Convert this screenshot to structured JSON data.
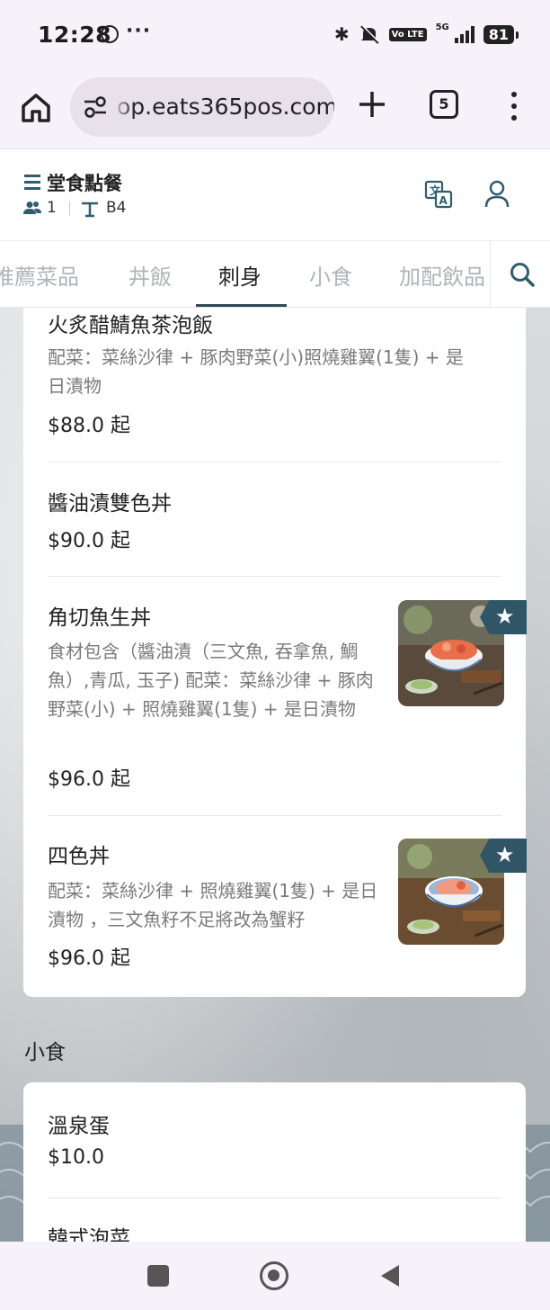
{
  "status_bar": {
    "time": "12:28",
    "more": "···",
    "network": "5G",
    "volte": "Vo LTE",
    "battery": "81"
  },
  "browser": {
    "url": "op.eats365pos.com",
    "tab_count": "5"
  },
  "header": {
    "title": "堂食點餐",
    "party_count": "1",
    "table": "B4"
  },
  "categories": [
    {
      "label": "推薦菜品"
    },
    {
      "label": "丼飯"
    },
    {
      "label": "刺身"
    },
    {
      "label": "小食"
    },
    {
      "label": "加配飲品"
    }
  ],
  "active_category": "刺身",
  "items": [
    {
      "name": "火炙醋鯖魚茶泡飯",
      "desc": "配菜：菜絲沙律 + 豚肉野菜(小)照燒雞翼(1隻) + 是日漬物",
      "price": "$88.0 起"
    },
    {
      "name": "醬油漬雙色丼",
      "price": "$90.0 起"
    },
    {
      "name": "角切魚生丼",
      "desc": "食材包含（醬油漬（三文魚, 吞拿魚, 鯛魚）,青瓜, 玉子) 配菜：菜絲沙律 + 豚肉野菜(小) + 照燒雞翼(1隻) + 是日漬物",
      "price": "$96.0 起",
      "featured": true
    },
    {
      "name": "四色丼",
      "desc": "配菜：菜絲沙律 + 照燒雞翼(1隻) + 是日漬物 ，三文魚籽不足將改為蟹籽",
      "price": "$96.0 起",
      "featured": true
    }
  ],
  "section2": {
    "title": "小食",
    "items": [
      {
        "name": "溫泉蛋",
        "price": "$10.0"
      },
      {
        "name": "韓式泡菜"
      }
    ]
  },
  "colors": {
    "accent": "#2f5566",
    "muted_text": "#7a7a7a",
    "inactive_tab": "#b0b4b8"
  }
}
